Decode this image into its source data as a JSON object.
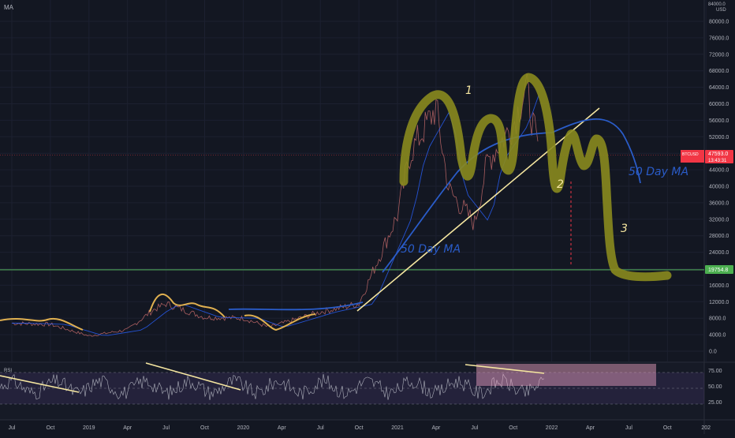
{
  "header": {
    "indicator_label": "MA",
    "currency": "USD",
    "top_price_cut": "84000.0"
  },
  "price_axis": {
    "ticks": [
      "80000.0",
      "76000.0",
      "72000.0",
      "68000.0",
      "64000.0",
      "60000.0",
      "56000.0",
      "52000.0",
      "48000.0",
      "44000.0",
      "40000.0",
      "36000.0",
      "32000.0",
      "28000.0",
      "24000.0",
      "20000.0",
      "16000.0",
      "12000.0",
      "8000.0",
      "4000.0",
      "0.0"
    ]
  },
  "symbol_tag": {
    "symbol": "BTCUSD",
    "price": "47593.0",
    "countdown": "13:43:31",
    "color": "#f23645"
  },
  "level_tag": {
    "price": "19754.8",
    "color": "#4caf50"
  },
  "rsi": {
    "label": "RSI",
    "ticks": [
      "75.00",
      "50.00",
      "25.00"
    ],
    "band_color": "#7e57c2"
  },
  "time_axis": {
    "labels": [
      "Jul",
      "Oct",
      "2019",
      "Apr",
      "Jul",
      "Oct",
      "2020",
      "Apr",
      "Jul",
      "Oct",
      "2021",
      "Apr",
      "Jul",
      "Oct",
      "2022",
      "Apr",
      "Jul",
      "Oct",
      "202"
    ]
  },
  "annotations": {
    "ma_label_lower": "50 Day MA",
    "ma_label_right": "50 Day MA",
    "step_1": "1",
    "step_2": "2",
    "step_3": "3",
    "ma_color": "#2a5cc9",
    "marker_color": "#8a8a1e",
    "trend_color": "#f5e6a0"
  },
  "chart_data": {
    "type": "line",
    "title": "",
    "series": [
      {
        "x": [
          "2018-07",
          "2018-10",
          "2019-01",
          "2019-04",
          "2019-06",
          "2019-07",
          "2019-10",
          "2020-01",
          "2020-03",
          "2020-07",
          "2020-10",
          "2021-01",
          "2021-02",
          "2021-04",
          "2021-05",
          "2021-07",
          "2021-08",
          "2021-10",
          "2021-11",
          "2021-12"
        ],
        "values": [
          6800,
          6500,
          3700,
          5200,
          10000,
          11500,
          8200,
          8000,
          5800,
          9500,
          11500,
          33000,
          48000,
          59000,
          39000,
          31000,
          46000,
          55000,
          64000,
          47593
        ]
      }
    ],
    "ylim": [
      0,
      84000
    ],
    "horizontal_level": 19754.8,
    "rsi_levels": [
      75,
      50,
      25
    ]
  }
}
